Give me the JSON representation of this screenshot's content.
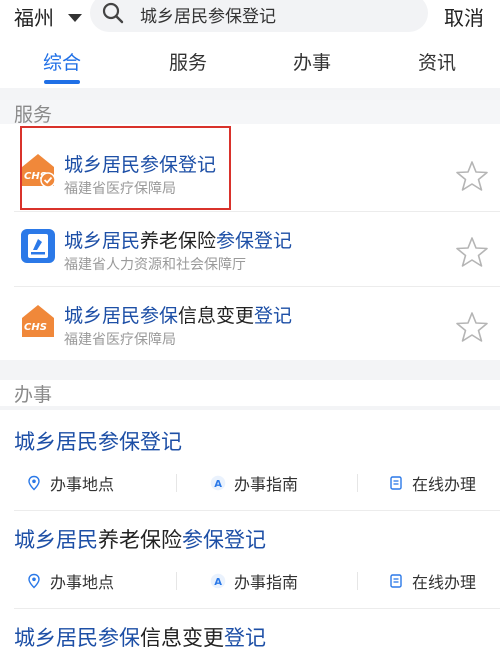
{
  "header": {
    "city": "福州",
    "search_value": "城乡居民参保登记",
    "cancel_label": "取消"
  },
  "tabs": [
    {
      "label": "综合",
      "active": true
    },
    {
      "label": "服务",
      "active": false
    },
    {
      "label": "办事",
      "active": false
    },
    {
      "label": "资讯",
      "active": false
    }
  ],
  "services_section": {
    "label": "服务",
    "items": [
      {
        "title_hl": "城乡居民参保登记",
        "title_plain": "",
        "title_hl2": "",
        "title_plain2": "",
        "subtitle": "福建省医疗保障局",
        "icon": "chs-medical-icon"
      },
      {
        "title_hl": "城乡居民",
        "title_plain": "养老保险",
        "title_hl2": "参保登记",
        "title_plain2": "",
        "subtitle": "福建省人力资源和社会保障厅",
        "icon": "pension-app-icon"
      },
      {
        "title_hl": "城乡居民参保",
        "title_plain": "信息变更",
        "title_hl2": "登记",
        "title_plain2": "",
        "subtitle": "福建省医疗保障局",
        "icon": "chs-medical-icon"
      }
    ]
  },
  "affairs_section": {
    "label": "办事",
    "actions": {
      "location": "办事地点",
      "guide": "办事指南",
      "online": "在线办理"
    },
    "items": [
      {
        "title_hl": "城乡居民参保登记",
        "title_plain": "",
        "title_hl2": ""
      },
      {
        "title_hl": "城乡居民",
        "title_plain": "养老保险",
        "title_hl2": "参保登记"
      },
      {
        "title_hl": "城乡居民参保",
        "title_plain": "信息变更",
        "title_hl2": "登记"
      }
    ]
  },
  "colors": {
    "accent": "#1f6fe6",
    "highlight_text": "#1d4fa6",
    "chs_orange": "#f0883a",
    "highlight_box": "#d9322b"
  }
}
